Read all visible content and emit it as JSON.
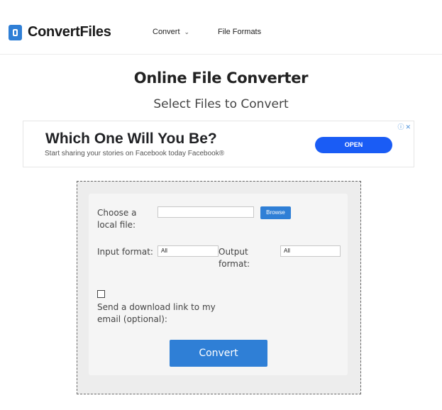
{
  "header": {
    "logo_text": "ConvertFiles",
    "nav": [
      {
        "label": "Convert",
        "has_dropdown": true
      },
      {
        "label": "File Formats",
        "has_dropdown": false
      }
    ]
  },
  "main": {
    "title": "Online File Converter",
    "subtitle": "Select Files to Convert"
  },
  "ad": {
    "headline": "Which One Will You Be?",
    "subtext": "Start sharing your stories on Facebook today Facebook®",
    "button_label": "OPEN",
    "info_icon": "info-icon",
    "close_icon": "close-icon"
  },
  "converter": {
    "local_file_label": "Choose a local file:",
    "file_value": "",
    "browse_label": "Browse",
    "input_format_label": "Input format:",
    "input_format_value": "All",
    "output_format_label": "Output format:",
    "output_format_value": "All",
    "email_label": "Send a download link to my email (optional):",
    "email_checked": false,
    "convert_label": "Convert"
  },
  "colors": {
    "accent": "#2f7fd6",
    "ad_button": "#1a5cf5"
  }
}
